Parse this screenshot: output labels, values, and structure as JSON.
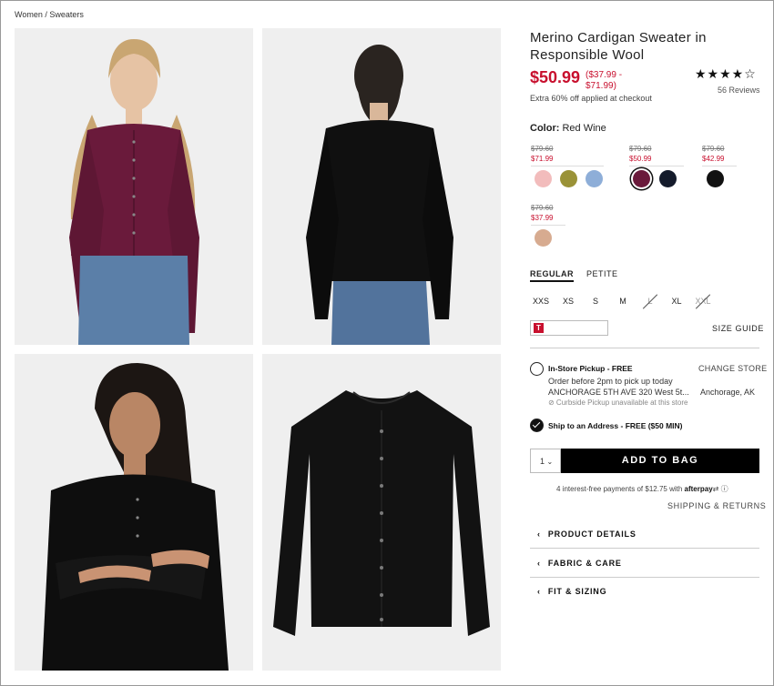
{
  "breadcrumb": "Women / Sweaters",
  "product": {
    "title": "Merino Cardigan Sweater in Responsible Wool",
    "price": "$50.99",
    "price_range": "($37.99 - $71.99)",
    "promo": "Extra 60% off applied at checkout",
    "rating_stars": "★★★★☆",
    "rating_value": 4.5,
    "reviews": "56 Reviews"
  },
  "color": {
    "label": "Color:",
    "selected": "Red Wine",
    "price_groups": [
      {
        "old": "$79.60",
        "new": "$71.99"
      },
      {
        "old": "$79.60",
        "new": "$50.99"
      },
      {
        "old": "$79.60",
        "new": "$42.99"
      },
      {
        "old": "$79.60",
        "new": "$37.99"
      }
    ],
    "swatches": [
      {
        "name": "pink",
        "hex": "#f2bcbc"
      },
      {
        "name": "olive",
        "hex": "#9a9237"
      },
      {
        "name": "light-blue",
        "hex": "#8eaed8"
      },
      {
        "name": "red-wine",
        "hex": "#6a1a3b"
      },
      {
        "name": "navy",
        "hex": "#141b2b"
      },
      {
        "name": "black",
        "hex": "#111111"
      },
      {
        "name": "camel",
        "hex": "#d7ab90"
      }
    ]
  },
  "fit": {
    "tabs": [
      "REGULAR",
      "PETITE"
    ],
    "active": "REGULAR"
  },
  "sizes": [
    {
      "label": "XXS",
      "available": true
    },
    {
      "label": "XS",
      "available": true
    },
    {
      "label": "S",
      "available": true
    },
    {
      "label": "M",
      "available": true
    },
    {
      "label": "L",
      "available": false
    },
    {
      "label": "XL",
      "available": true
    },
    {
      "label": "XXL",
      "available": false
    }
  ],
  "size_guide": "SIZE GUIDE",
  "pickup": {
    "title": "In-Store Pickup - FREE",
    "line1": "Order before 2pm to pick up today",
    "line2": "ANCHORAGE 5TH AVE 320 West 5t...",
    "city": "Anchorage, AK",
    "curbside": "⊘ Curbside Pickup unavailable at this store",
    "change_store": "CHANGE STORE"
  },
  "ship": {
    "title": "Ship to an Address - FREE ($50 MIN)"
  },
  "quantity": "1",
  "add_to_bag": "ADD TO BAG",
  "afterpay": {
    "text": "4 interest-free payments of $12.75 with",
    "brand": "afterpay",
    "info": "ⓘ"
  },
  "shipping_returns": "SHIPPING & RETURNS",
  "accordions": [
    "PRODUCT DETAILS",
    "FABRIC & CARE",
    "FIT & SIZING"
  ],
  "colors": {
    "sale_red": "#c8102e",
    "wine": "#6a1a3b",
    "black": "#111111"
  }
}
